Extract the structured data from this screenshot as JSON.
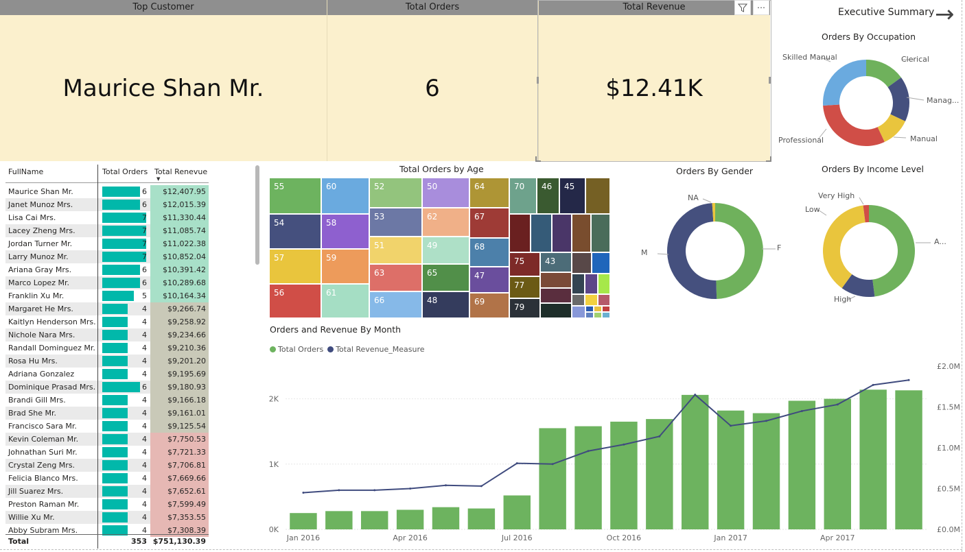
{
  "kpis": [
    {
      "header": "Top Customer",
      "value": "Maurice Shan Mr."
    },
    {
      "header": "Total Orders",
      "value": "6"
    },
    {
      "header": "Total Revenue",
      "value": "$12.41K"
    }
  ],
  "visual_header": {
    "filter_icon": "filter-icon",
    "more_label": "⋯"
  },
  "nav": {
    "title": "Executive Summary",
    "arrow": "→"
  },
  "table": {
    "columns": [
      "FullName",
      "Total Orders",
      "Total Renevue"
    ],
    "rows": [
      {
        "name": "Maurice Shan Mr.",
        "orders": "6",
        "revenue": "$12,407.95"
      },
      {
        "name": "Janet Munoz Mrs.",
        "orders": "6",
        "revenue": "$12,015.39"
      },
      {
        "name": "Lisa Cai Mrs.",
        "orders": "7",
        "revenue": "$11,330.44"
      },
      {
        "name": "Lacey Zheng Mrs.",
        "orders": "7",
        "revenue": "$11,085.74"
      },
      {
        "name": "Jordan Turner Mr.",
        "orders": "7",
        "revenue": "$11,022.38"
      },
      {
        "name": "Larry Munoz Mr.",
        "orders": "7",
        "revenue": "$10,852.04"
      },
      {
        "name": "Ariana Gray Mrs.",
        "orders": "6",
        "revenue": "$10,391.42"
      },
      {
        "name": "Marco Lopez Mr.",
        "orders": "6",
        "revenue": "$10,289.68"
      },
      {
        "name": "Franklin Xu Mr.",
        "orders": "5",
        "revenue": "$10,164.34"
      },
      {
        "name": "Margaret He Mrs.",
        "orders": "4",
        "revenue": "$9,266.74"
      },
      {
        "name": "Kaitlyn Henderson Mrs.",
        "orders": "4",
        "revenue": "$9,258.92"
      },
      {
        "name": "Nichole Nara Mrs.",
        "orders": "4",
        "revenue": "$9,234.66"
      },
      {
        "name": "Randall Dominguez Mr.",
        "orders": "4",
        "revenue": "$9,210.36"
      },
      {
        "name": "Rosa Hu Mrs.",
        "orders": "4",
        "revenue": "$9,201.20"
      },
      {
        "name": "Adriana Gonzalez",
        "orders": "4",
        "revenue": "$9,195.69"
      },
      {
        "name": "Dominique Prasad Mrs.",
        "orders": "6",
        "revenue": "$9,180.93"
      },
      {
        "name": "Brandi Gill Mrs.",
        "orders": "4",
        "revenue": "$9,166.18"
      },
      {
        "name": "Brad She Mr.",
        "orders": "4",
        "revenue": "$9,161.01"
      },
      {
        "name": "Francisco Sara Mr.",
        "orders": "4",
        "revenue": "$9,125.54"
      },
      {
        "name": "Kevin Coleman Mr.",
        "orders": "4",
        "revenue": "$7,750.53"
      },
      {
        "name": "Johnathan Suri Mr.",
        "orders": "4",
        "revenue": "$7,721.33"
      },
      {
        "name": "Crystal Zeng Mrs.",
        "orders": "4",
        "revenue": "$7,706.81"
      },
      {
        "name": "Felicia Blanco Mrs.",
        "orders": "4",
        "revenue": "$7,669.66"
      },
      {
        "name": "Jill Suarez Mrs.",
        "orders": "4",
        "revenue": "$7,652.61"
      },
      {
        "name": "Preston Raman Mr.",
        "orders": "4",
        "revenue": "$7,599.49"
      },
      {
        "name": "Willie Xu Mr.",
        "orders": "4",
        "revenue": "$7,353.55"
      },
      {
        "name": "Abby Subram Mrs.",
        "orders": "4",
        "revenue": "$7,308.39"
      }
    ],
    "total": {
      "label": "Total",
      "orders": "353",
      "revenue": "$751,130.39"
    },
    "colors": {
      "bar": "#01b8aa",
      "rev_high": "#a8e0c8",
      "rev_mid": "#c9c9b8",
      "rev_low": "#e6b8b4"
    }
  },
  "treemap": {
    "title": "Total Orders by Age",
    "cells": [
      "55",
      "54",
      "57",
      "56",
      "60",
      "58",
      "59",
      "61",
      "52",
      "53",
      "51",
      "63",
      "66",
      "50",
      "62",
      "49",
      "65",
      "48",
      "64",
      "67",
      "68",
      "47",
      "69",
      "70",
      "46",
      "45",
      "75",
      "43",
      "77",
      "79"
    ]
  },
  "chart_data": [
    {
      "type": "pie",
      "title": "Orders By Occupation",
      "labels": [
        "Clerical",
        "Manag...",
        "Manual",
        "Professional",
        "Skilled Manual"
      ],
      "values": [
        15,
        17,
        11,
        31,
        26
      ],
      "colors": [
        "#6fb15c",
        "#45507e",
        "#e9c53d",
        "#d04e47",
        "#6aaadf"
      ]
    },
    {
      "type": "pie",
      "title": "Orders By Gender",
      "labels": [
        "F",
        "M",
        "NA"
      ],
      "values": [
        49.5,
        49.5,
        1
      ],
      "colors": [
        "#6fb15c",
        "#45507e",
        "#e9c53d"
      ]
    },
    {
      "type": "pie",
      "title": "Orders By Income Level",
      "labels": [
        "A...",
        "High",
        "Low",
        "Very High"
      ],
      "values": [
        48,
        12,
        38,
        2
      ],
      "colors": [
        "#6fb15c",
        "#45507e",
        "#e9c53d",
        "#d04e47"
      ]
    },
    {
      "type": "bar",
      "title": "Orders and Revenue By Month",
      "legend": [
        "Total Orders",
        "Total Revenue_Measure"
      ],
      "x_tick_labels": [
        "Jan 2016",
        "Apr 2016",
        "Jul 2016",
        "Oct 2016",
        "Jan 2017",
        "Apr 2017"
      ],
      "y_tick_labels": [
        "0K",
        "1K",
        "2K"
      ],
      "y2_tick_labels": [
        "£0.0M",
        "£0.5M",
        "£1.0M",
        "£1.5M",
        "£2.0M"
      ],
      "ylim": [
        0,
        2500
      ],
      "y2lim": [
        0,
        2.0
      ],
      "categories": [
        "Jan 2016",
        "Feb 2016",
        "Mar 2016",
        "Apr 2016",
        "May 2016",
        "Jun 2016",
        "Jul 2016",
        "Aug 2016",
        "Sep 2016",
        "Oct 2016",
        "Nov 2016",
        "Dec 2016",
        "Jan 2017",
        "Feb 2017",
        "Mar 2017",
        "Apr 2017",
        "May 2017",
        "Jun 2017"
      ],
      "series": [
        {
          "name": "Total Orders",
          "values": [
            250,
            280,
            280,
            300,
            340,
            320,
            520,
            1550,
            1580,
            1650,
            1690,
            2060,
            1820,
            1780,
            1970,
            2000,
            2140,
            2130
          ]
        },
        {
          "name": "Total Revenue_Measure",
          "values": [
            0.45,
            0.48,
            0.48,
            0.5,
            0.54,
            0.53,
            0.81,
            0.8,
            0.96,
            1.04,
            1.14,
            1.65,
            1.27,
            1.33,
            1.45,
            1.53,
            1.77,
            1.83
          ]
        }
      ],
      "colors": {
        "bars": "#6db35f",
        "line": "#3f4b7e"
      }
    }
  ]
}
